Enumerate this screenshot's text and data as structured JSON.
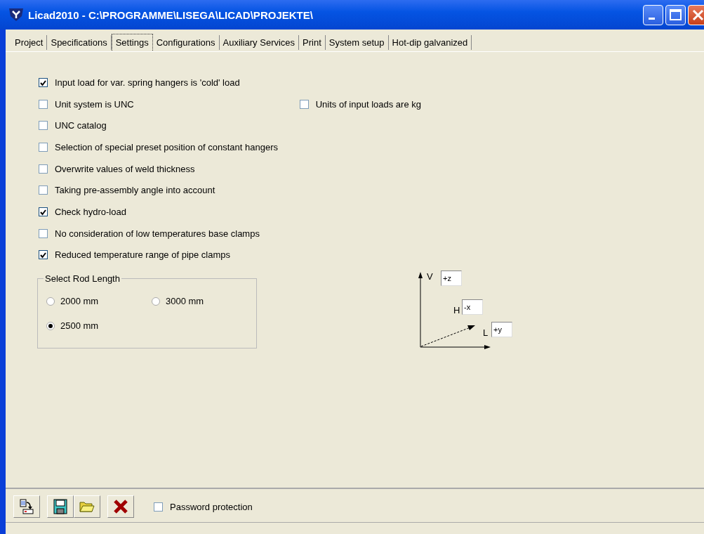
{
  "window": {
    "title": "Licad2010 - C:\\PROGRAMME\\LISEGA\\LICAD\\PROJEKTE\\"
  },
  "tabs": [
    {
      "label": "Project",
      "selected": false
    },
    {
      "label": "Specifications",
      "selected": false
    },
    {
      "label": "Settings",
      "selected": true
    },
    {
      "label": "Configurations",
      "selected": false
    },
    {
      "label": "Auxiliary Services",
      "selected": false
    },
    {
      "label": "Print",
      "selected": false
    },
    {
      "label": "System setup",
      "selected": false
    },
    {
      "label": "Hot-dip galvanized",
      "selected": false
    }
  ],
  "option_rows": [
    [
      {
        "label": "Input load for var. spring hangers is 'cold' load",
        "checked": true
      }
    ],
    [
      {
        "label": "Unit system is UNC",
        "checked": false
      },
      {
        "label": "Units of input loads are kg",
        "checked": false
      }
    ],
    [
      {
        "label": "UNC catalog",
        "checked": false
      }
    ],
    [
      {
        "label": "Selection of special preset position of constant hangers",
        "checked": false
      }
    ],
    [
      {
        "label": "Overwrite values of weld thickness",
        "checked": false
      }
    ],
    [
      {
        "label": "Taking pre-assembly angle into account",
        "checked": false
      }
    ],
    [
      {
        "label": "Check hydro-load",
        "checked": true
      }
    ],
    [
      {
        "label": "No consideration of low temperatures base clamps",
        "checked": false
      }
    ],
    [
      {
        "label": "Reduced temperature range of pipe clamps",
        "checked": true
      }
    ]
  ],
  "rod_length": {
    "title": "Select Rod Length",
    "options": [
      {
        "label": "2000 mm",
        "selected": false
      },
      {
        "label": "3000 mm",
        "selected": false
      },
      {
        "label": "2500 mm",
        "selected": true
      }
    ]
  },
  "axes": [
    {
      "label": "V",
      "value": "+z"
    },
    {
      "label": "H",
      "value": "-x"
    },
    {
      "label": "L",
      "value": "+y"
    }
  ],
  "password": {
    "label": "Password protection",
    "checked": false
  }
}
